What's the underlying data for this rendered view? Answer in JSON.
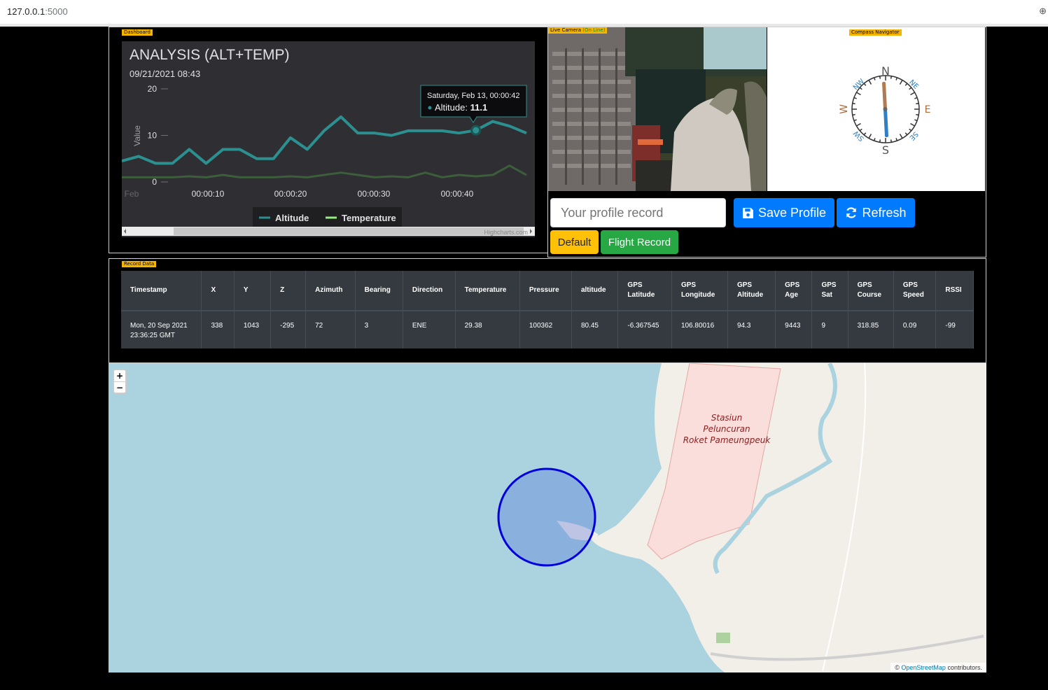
{
  "browser": {
    "url_host": "127.0.0.1",
    "url_port": ":5000"
  },
  "tags": {
    "dashboard": "Dashboard",
    "live_camera": "Live Camera",
    "live_camera_status": "(On Line)",
    "compass": "Compass Navigator",
    "record_data": "Record Data"
  },
  "chart_data": {
    "type": "line",
    "title": "ANALYSIS (ALT+TEMP)",
    "subtitle": "09/21/2021 08:43",
    "ylabel": "Value",
    "xlabel": "",
    "ylim": [
      0,
      20
    ],
    "yticks": [
      "0",
      "10",
      "20"
    ],
    "xticks": [
      "Feb",
      "00:00:10",
      "00:00:20",
      "00:00:30",
      "00:00:40"
    ],
    "xlim": [
      0,
      49
    ],
    "series": [
      {
        "name": "Altitude",
        "color": "#2b908f",
        "x": [
          0,
          2,
          4,
          6,
          8,
          10,
          12,
          14,
          16,
          18,
          20,
          22,
          24,
          26,
          28,
          30,
          32,
          34,
          36,
          38,
          40,
          42,
          44,
          46,
          48
        ],
        "values": [
          4.5,
          5.5,
          4,
          4,
          7,
          4,
          7,
          7,
          5,
          5,
          9.5,
          7,
          11,
          14,
          10.5,
          10.5,
          10,
          11,
          11,
          11,
          10.5,
          11.1,
          13,
          12,
          10.5
        ]
      },
      {
        "name": "Temperature",
        "color": "#90ee7e",
        "x": [
          0,
          2,
          4,
          6,
          8,
          10,
          12,
          14,
          16,
          18,
          20,
          22,
          24,
          26,
          28,
          30,
          32,
          34,
          36,
          38,
          40,
          42,
          44,
          46,
          48
        ],
        "values": [
          1,
          1,
          1,
          1,
          1.2,
          1,
          1.5,
          1,
          1,
          1,
          1.2,
          1,
          1.5,
          2,
          1.5,
          1,
          1.2,
          1,
          2,
          1,
          1.5,
          1.2,
          1.5,
          3.5,
          1.5
        ]
      }
    ],
    "tooltip": {
      "title": "Saturday, Feb 13, 00:00:42",
      "series": "Altitude",
      "value": "11.1"
    },
    "credits": "Highcharts.com",
    "legend_position": "bottom"
  },
  "compass": {
    "N": "N",
    "NE": "NE",
    "E": "E",
    "SE": "SE",
    "S": "S",
    "SW": "SW",
    "W": "W",
    "NW": "NW"
  },
  "controls": {
    "profile_placeholder": "Your profile record",
    "save_label": "Save Profile",
    "refresh_label": "Refresh",
    "default_label": "Default",
    "flight_label": "Flight Record"
  },
  "table": {
    "headers": [
      [
        "Timestamp"
      ],
      [
        "X"
      ],
      [
        "Y"
      ],
      [
        "Z"
      ],
      [
        "Azimuth"
      ],
      [
        "Bearing"
      ],
      [
        "Direction"
      ],
      [
        "Temperature"
      ],
      [
        "Pressure"
      ],
      [
        "altitude"
      ],
      [
        "GPS",
        "Latitude"
      ],
      [
        "GPS",
        "Longitude"
      ],
      [
        "GPS",
        "Altitude"
      ],
      [
        "GPS",
        "Age"
      ],
      [
        "GPS",
        "Sat"
      ],
      [
        "GPS",
        "Course"
      ],
      [
        "GPS",
        "Speed"
      ],
      [
        "RSSI"
      ]
    ],
    "row": [
      [
        "Mon, 20 Sep 2021",
        "23:36:25 GMT"
      ],
      [
        "338"
      ],
      [
        "1043"
      ],
      [
        "-295"
      ],
      [
        "72"
      ],
      [
        "3"
      ],
      [
        "ENE"
      ],
      [
        "29.38"
      ],
      [
        "100362"
      ],
      [
        "80.45"
      ],
      [
        "-6.367545"
      ],
      [
        "106.80016"
      ],
      [
        "94.3"
      ],
      [
        "9443"
      ],
      [
        "9"
      ],
      [
        "318.85"
      ],
      [
        "0.09"
      ],
      [
        "-99"
      ]
    ]
  },
  "map": {
    "zoom_in": "+",
    "zoom_out": "−",
    "label_lines": [
      "Stasiun",
      "Peluncuran",
      "Roket Pameungpeuk"
    ],
    "attribution_prefix": "©",
    "attribution_link": "OpenStreetMap",
    "attribution_suffix": "contributors."
  }
}
